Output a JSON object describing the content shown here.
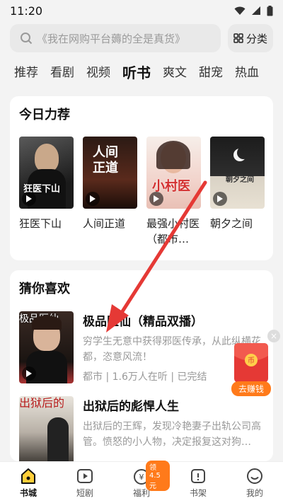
{
  "status": {
    "time": "11:20"
  },
  "search": {
    "placeholder": "《我在网购平台薅的全是真货》",
    "category_label": "分类"
  },
  "tabs": [
    {
      "label": "推荐",
      "active": false
    },
    {
      "label": "看剧",
      "active": false
    },
    {
      "label": "视频",
      "active": false
    },
    {
      "label": "听书",
      "active": true
    },
    {
      "label": "爽文",
      "active": false
    },
    {
      "label": "甜宠",
      "active": false
    },
    {
      "label": "热血",
      "active": false
    }
  ],
  "today": {
    "title": "今日力荐",
    "books": [
      {
        "name": "狂医下山",
        "cover_text": "狂医下山"
      },
      {
        "name": "人间正道",
        "cover_text": "人间\n正道"
      },
      {
        "name": "最强小村医（都市…",
        "cover_text": "小村医"
      },
      {
        "name": "朝夕之间",
        "cover_text": "朝夕之间"
      }
    ]
  },
  "guess": {
    "title": "猜你喜欢",
    "items": [
      {
        "title": "极品医仙（精品双播）",
        "desc": "穷学生无意中获得邪医传承，从此纵横花都，恣意风流！",
        "meta": "都市 | 1.6万人在听 | 已完结",
        "cover_text": "极品医仙"
      },
      {
        "title": "出狱后的彪悍人生",
        "desc": "出狱后的王辉，发现冷艳妻子出轨公司高管。愤怒的小人物，决定报复这对狗…",
        "meta": "",
        "cover_text": "出狱后的"
      }
    ]
  },
  "float_reward": {
    "label": "去赚钱"
  },
  "bottom_nav": [
    {
      "label": "书城",
      "icon": "home-icon",
      "active": true,
      "badge": ""
    },
    {
      "label": "短剧",
      "icon": "play-icon",
      "active": false,
      "badge": ""
    },
    {
      "label": "福利",
      "icon": "coin-icon",
      "active": false,
      "badge": "领4.5元"
    },
    {
      "label": "书架",
      "icon": "bookshelf-icon",
      "active": false,
      "badge": ""
    },
    {
      "label": "我的",
      "icon": "profile-icon",
      "active": false,
      "badge": ""
    }
  ],
  "colors": {
    "accent": "#e53935",
    "reward": "#ff7a1a"
  }
}
